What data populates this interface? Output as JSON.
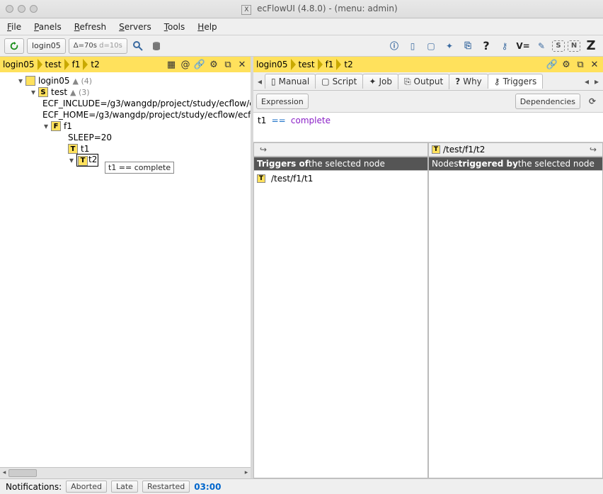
{
  "window": {
    "title": "ecFlowUI (4.8.0) - (menu: admin)"
  },
  "menubar": {
    "file": "File",
    "panels": "Panels",
    "refresh": "Refresh",
    "servers": "Servers",
    "tools": "Tools",
    "help": "Help"
  },
  "toolbar": {
    "server": "login05",
    "delta": "Δ=70s",
    "d": "d=10s"
  },
  "left": {
    "crumbs": [
      "login05",
      "test",
      "f1",
      "t2"
    ],
    "tree": {
      "root": "login05",
      "root_count": "(4)",
      "suite": "test",
      "suite_count": "(3)",
      "var1": "ECF_INCLUDE=/g3/wangdp/project/study/ecflow/ecflo…",
      "var2": "ECF_HOME=/g3/wangdp/project/study/ecflow/ecflo…",
      "family": "f1",
      "sleep": "SLEEP=20",
      "task1": "t1",
      "task2": "t2",
      "tooltip": "t1 == complete"
    }
  },
  "right": {
    "crumbs": [
      "login05",
      "test",
      "f1",
      "t2"
    ],
    "tabs": {
      "manual": "Manual",
      "script": "Script",
      "job": "Job",
      "output": "Output",
      "why": "Why",
      "triggers": "Triggers"
    },
    "subbar": {
      "expression": "Expression",
      "dependencies": "Dependencies"
    },
    "expr": {
      "a": "t1",
      "op": "==",
      "b": "complete"
    },
    "path_header": "/test/f1/t2",
    "col1_a": "Triggers of",
    "col1_b": " the selected node",
    "col2_a": "Nodes ",
    "col2_b": "triggered by",
    "col2_c": " the selected node",
    "entry": "/test/f1/t1"
  },
  "status": {
    "label": "Notifications:",
    "aborted": "Aborted",
    "late": "Late",
    "restarted": "Restarted",
    "time": "03:00"
  }
}
